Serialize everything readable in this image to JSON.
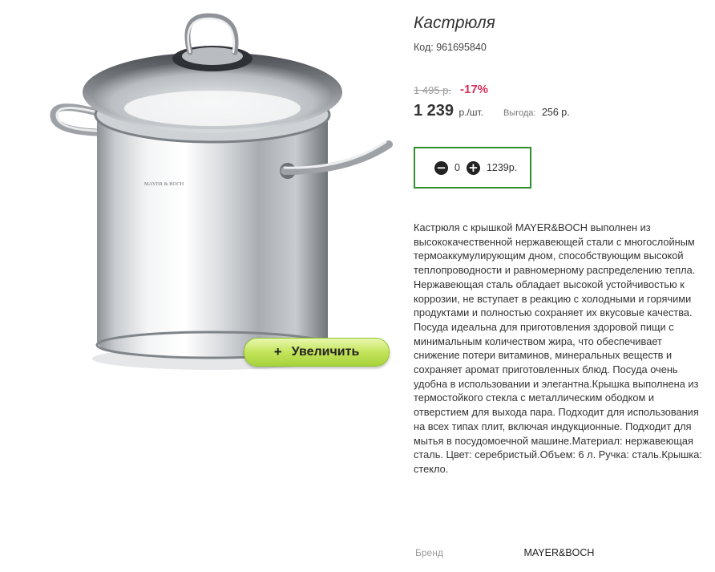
{
  "product": {
    "title": "Кастрюля",
    "code_label": "Код:",
    "code": "961695840",
    "image_brand_engraving": "MAYER & BOCH"
  },
  "zoom": {
    "plus": "+",
    "label": "Увеличить"
  },
  "pricing": {
    "old_price": "1 495 р.",
    "discount": "-17%",
    "price": "1 239",
    "price_unit": "р./шт.",
    "profit_label": "Выгода:",
    "profit_value": "256 р."
  },
  "cart": {
    "minus": "−",
    "quantity": "0",
    "plus": "+",
    "sum": "1239р."
  },
  "description": "Кастрюля с крышкой MAYER&BOCH выполнен из высококачественной нержавеющей стали с многослойным термоаккумулирующим дном, способствующим высокой теплопроводности и равномерному распределению тепла. Нержавеющая сталь обладает высокой устойчивостью к коррозии, не вступает в реакцию с холодными и горячими продуктами и полностью сохраняет их вкусовые качества. Посуда идеальна для приготовления здоровой пищи с минимальным количеством жира, что обеспечивает снижение потери витаминов, минеральных веществ и сохраняет аромат приготовленных блюд. Посуда очень удобна в использовании и элегантна.Крышка выполнена из термостойкого стекла с металлическим ободком и отверстием для выхода пара. Подходит для использования на всех типах плит, включая индукционные. Подходит для мытья в посудомоечной машине.Материал: нержавеющая сталь. Цвет: серебристый.Объем: 6 л. Ручка: сталь.Крышка: стекло.",
  "brand": {
    "label": "Бренд",
    "value": "MAYER&BOCH"
  },
  "colors": {
    "accent_red": "#d9305a",
    "cart_border": "#2f8f2f",
    "zoom_green": "#b5dc45"
  }
}
